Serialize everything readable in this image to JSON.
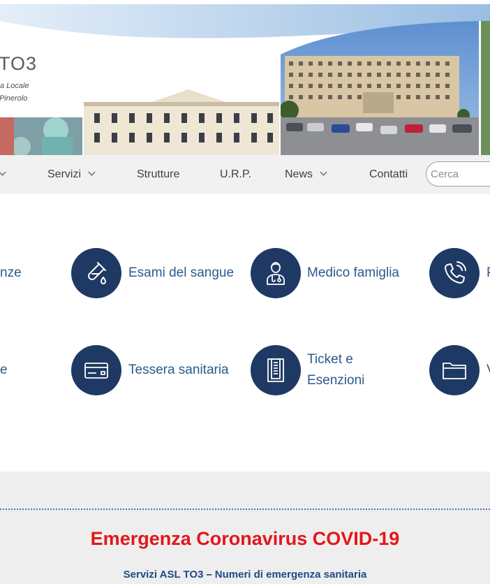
{
  "banner": {
    "logo_big": "TO3",
    "logo_line1": "a Locale",
    "logo_line2": "Pinerolo"
  },
  "nav": {
    "items": [
      {
        "label": "Servizi",
        "has_dropdown": true
      },
      {
        "label": "Strutture",
        "has_dropdown": false
      },
      {
        "label": "U.R.P.",
        "has_dropdown": false
      },
      {
        "label": "News",
        "has_dropdown": true
      },
      {
        "label": "Contatti",
        "has_dropdown": false
      }
    ],
    "search_placeholder": "Cerca"
  },
  "quick_links": {
    "row1": {
      "partial_left": "nze",
      "items": [
        {
          "label": "Esami del sangue",
          "icon": "test-tube-icon"
        },
        {
          "label": "Medico famiglia",
          "icon": "doctor-icon"
        },
        {
          "label": "P",
          "icon": "phone-icon"
        }
      ]
    },
    "row2": {
      "partial_left": "e",
      "items": [
        {
          "label": "Tessera sanitaria",
          "icon": "card-icon"
        },
        {
          "label_line1": "Ticket e",
          "label_line2": "Esenzioni",
          "icon": "receipt-icon"
        },
        {
          "label": "V",
          "icon": "folder-icon"
        }
      ]
    }
  },
  "covid": {
    "title": "Emergenza Coronavirus COVID-19",
    "link1": "Servizi ASL TO3",
    "separator": "–",
    "link2": "Numeri di emergenza sanitaria"
  },
  "colors": {
    "accent_dark": "#1e3a64",
    "link_blue": "#2b5a8c",
    "covid_red": "#e3161b",
    "nav_bg": "#f1f1f1"
  }
}
